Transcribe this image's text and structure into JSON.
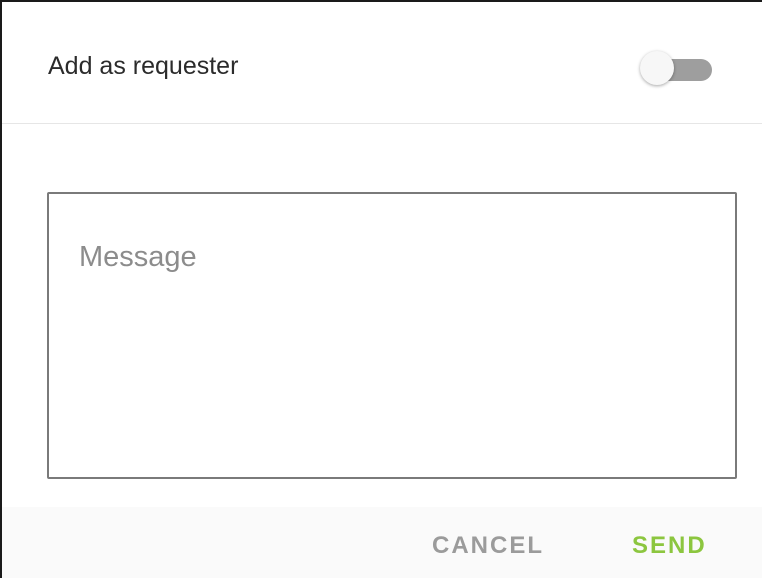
{
  "requester_toggle": {
    "label": "Add as requester",
    "checked": false
  },
  "message": {
    "placeholder": "Message",
    "value": ""
  },
  "actions": {
    "cancel_label": "CANCEL",
    "send_label": "SEND"
  },
  "colors": {
    "accent": "#8cc63f",
    "cancel_text": "#9b9b9b",
    "switch_track": "#9e9e9e",
    "switch_thumb": "#f7f7f7"
  }
}
